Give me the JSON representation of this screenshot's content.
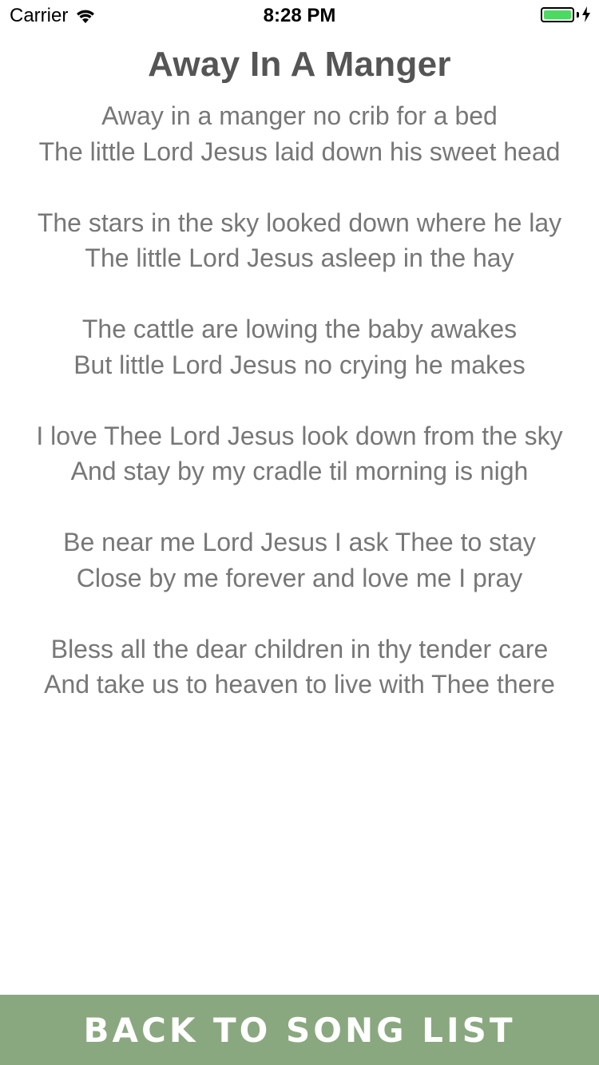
{
  "status_bar": {
    "carrier": "Carrier",
    "time": "8:28 PM",
    "battery_level": 1.0,
    "battery_color": "#4cd964",
    "charging": true
  },
  "song": {
    "title": "Away In A Manger",
    "verses": [
      [
        "Away in a manger no crib for a bed",
        "The little Lord Jesus laid down his sweet head"
      ],
      [
        "The stars in the sky looked down where he lay",
        "The little Lord Jesus asleep in the hay"
      ],
      [
        "The cattle are lowing the baby awakes",
        "But little Lord Jesus no crying he makes"
      ],
      [
        "I love Thee Lord Jesus look down from the sky",
        "And stay by my cradle til morning is nigh"
      ],
      [
        "Be near me Lord Jesus I ask Thee to stay",
        "Close by me forever and love me I pray"
      ],
      [
        "Bless all the dear children in thy tender care",
        "And take us to heaven to live with Thee there"
      ]
    ]
  },
  "footer": {
    "back_label": "Back to Song List",
    "button_color": "#8aa87f"
  }
}
